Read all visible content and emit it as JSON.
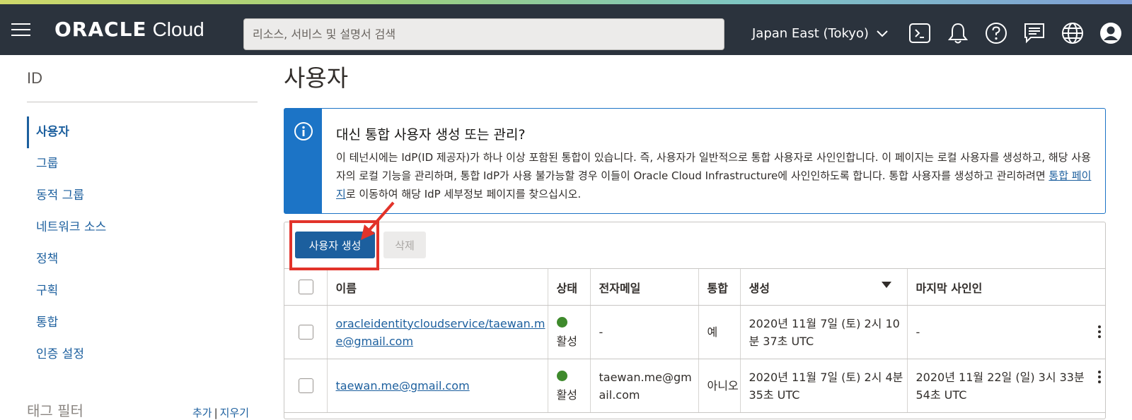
{
  "header": {
    "logo_brand": "ORACLE",
    "logo_product": "Cloud",
    "search_placeholder": "리소스, 서비스 및 설명서 검색",
    "region": "Japan East (Tokyo)"
  },
  "sidebar": {
    "title": "ID",
    "items": [
      {
        "label": "사용자",
        "active": true
      },
      {
        "label": "그룹"
      },
      {
        "label": "동적 그룹"
      },
      {
        "label": "네트워크 소스"
      },
      {
        "label": "정책"
      },
      {
        "label": "구획"
      },
      {
        "label": "통합"
      },
      {
        "label": "인증 설정"
      }
    ],
    "tag_filter": "태그 필터",
    "tag_add": "추가",
    "tag_sep": "|",
    "tag_clear": "지우기"
  },
  "main": {
    "title": "사용자",
    "info": {
      "title": "대신 통합 사용자 생성 또는 관리?",
      "body_before": "이 테넌시에는 IdP(ID 제공자)가 하나 이상 포함된 통합이 있습니다. 즉, 사용자가 일반적으로 통합 사용자로 사인인합니다. 이 페이지는 로컬 사용자를 생성하고, 해당 사용자의 로컬 기능을 관리하며, 통합 IdP가 사용 불가능할 경우 이들이 Oracle Cloud Infrastructure에 사인인하도록 합니다. 통합 사용자를 생성하고 관리하려면 ",
      "link": "통합 페이지",
      "body_after": "로 이동하여 해당 IdP 세부정보 페이지를 찾으십시오."
    },
    "buttons": {
      "create": "사용자 생성",
      "delete": "삭제"
    },
    "columns": [
      "이름",
      "상태",
      "전자메일",
      "통합",
      "생성",
      "마지막 사인인"
    ],
    "rows": [
      {
        "name": "oracleidentitycloudservice/taewan.me@gmail.com",
        "status": "활성",
        "email": "-",
        "federated": "예",
        "created": "2020년 11월 7일 (토) 2시 10분 37초 UTC",
        "last_signin": "-"
      },
      {
        "name": "taewan.me@gmail.com",
        "status": "활성",
        "email": "taewan.me@gmail.com",
        "federated": "아니오",
        "created": "2020년 11월 7일 (토) 2시 4분 35초 UTC",
        "last_signin": "2020년 11월 22일 (일) 3시 33분 54초 UTC"
      }
    ]
  },
  "colors": {
    "header": "#2b333d",
    "accent": "#1c5f9e",
    "info": "#1c74c6",
    "highlight": "#e2332a",
    "status_active": "#3e8a2c"
  }
}
